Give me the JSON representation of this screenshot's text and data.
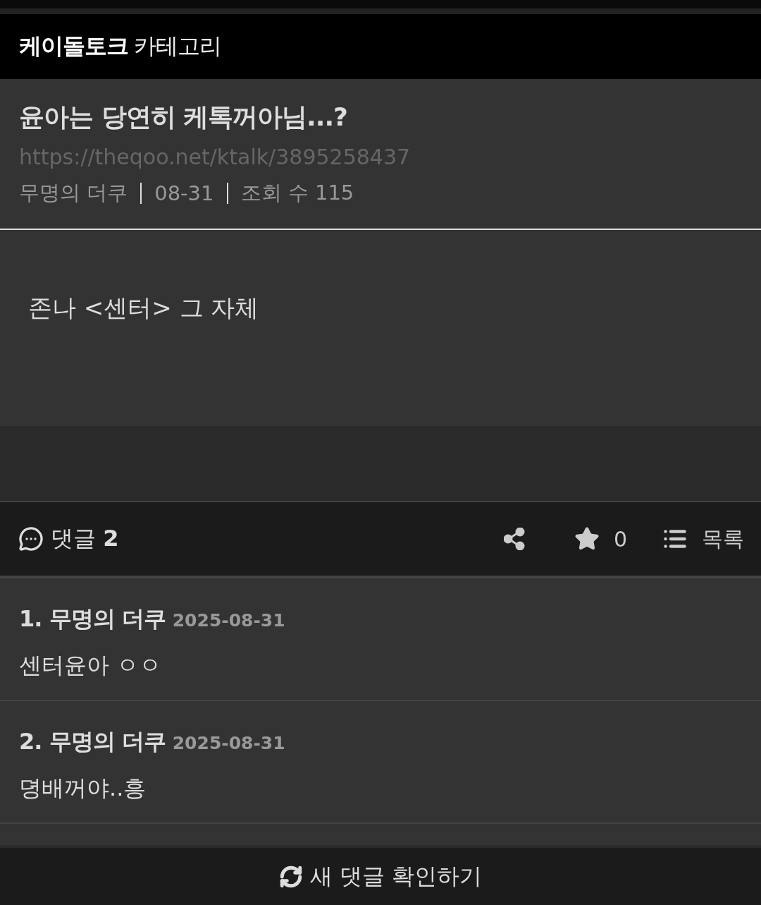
{
  "header": {
    "board": "케이돌토크",
    "label": "카테고리"
  },
  "post": {
    "title": "윤아는 당연히 케톡꺼아님...?",
    "url": "https://theqoo.net/ktalk/3895258437",
    "author": "무명의 더쿠",
    "date": "08-31",
    "views": "조회 수 115",
    "body": "존나 <센터> 그 자체"
  },
  "toolbar": {
    "comments": "댓글 **2**",
    "stars": "0",
    "list": "목록"
  },
  "comments": [
    {
      "heading": "1. 무명의 더쿠",
      "date": "2025-08-31",
      "text": "센터윤아 ㅇㅇ"
    },
    {
      "heading": "2. 무명의 더쿠",
      "date": "2025-08-31",
      "text": "뎡배꺼야..흥"
    }
  ],
  "refresh": "새 댓글 확인하기"
}
